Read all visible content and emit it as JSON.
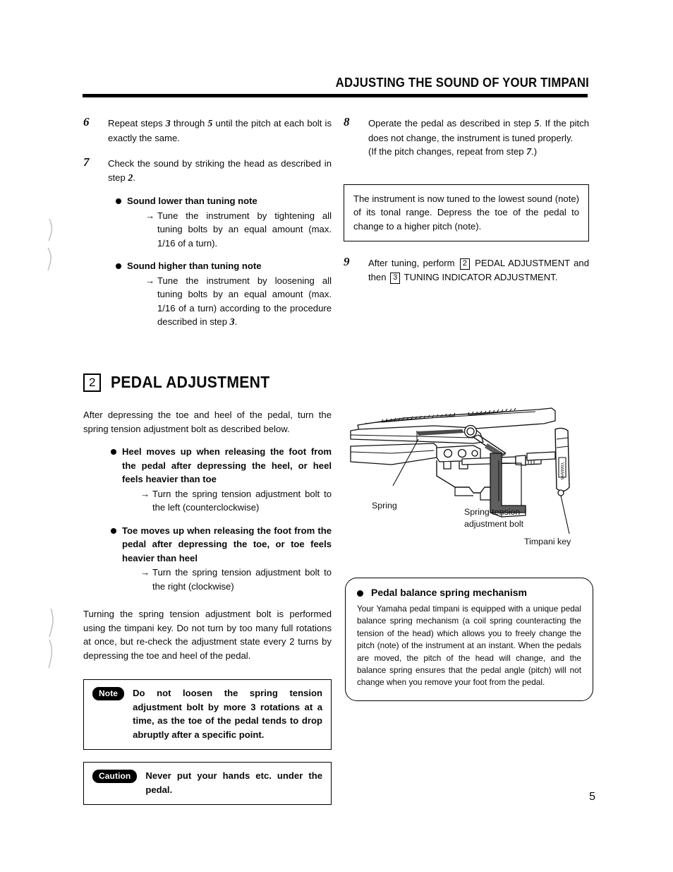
{
  "header": {
    "title": "ADJUSTING THE SOUND OF YOUR TIMPANI"
  },
  "left_column": {
    "step6": {
      "num": "6",
      "text_a": "Repeat steps ",
      "n3": "3",
      "text_b": " through ",
      "n5": "5",
      "text_c": " until the pitch at each bolt is exactly the same."
    },
    "step7": {
      "num": "7",
      "text_a": "Check the sound by striking the head as described in step ",
      "n2": "2",
      "text_b": "."
    },
    "bullet_lower": {
      "head": "Sound lower than tuning note",
      "arrow": "→",
      "detail": "Tune the instrument by tightening all tuning bolts by an equal amount (max. 1/16 of a turn)."
    },
    "bullet_higher": {
      "head": "Sound higher than tuning note",
      "arrow": "→",
      "detail_a": "Tune the instrument by loosening all tuning bolts by an equal amount (max. 1/16 of a turn) according to the procedure described in step ",
      "n3": "3",
      "detail_b": "."
    }
  },
  "right_column": {
    "step8": {
      "num": "8",
      "text_a": "Operate the pedal as described in step ",
      "n5": "5",
      "text_b": ". If the pitch does not change, the instrument is tuned properly.",
      "line2_a": "(If the pitch changes, repeat from step ",
      "n7": "7",
      "line2_b": ".)"
    },
    "info_box": "The instrument is now tuned to the lowest sound (note) of its tonal range. Depress the toe of the pedal to change to a higher pitch (note).",
    "step9": {
      "num": "9",
      "text_a": "After tuning, perform ",
      "box2": "2",
      "text_b": " PEDAL ADJUSTMENT and then ",
      "box3": "3",
      "text_c": " TUNING INDICATOR ADJUSTMENT."
    }
  },
  "section": {
    "number": "2",
    "title": "PEDAL ADJUSTMENT",
    "intro": "After depressing the toe and heel of the pedal, turn the spring tension adjustment bolt as described below.",
    "bullet_heel": {
      "head": "Heel moves up when releasing the foot from the pedal after depressing the heel, or heel feels heavier than toe",
      "arrow": "→",
      "detail": "Turn the spring tension adjustment bolt to the left (counterclockwise)"
    },
    "bullet_toe": {
      "head": "Toe moves up when releasing the foot from the pedal after depressing the toe, or toe feels heavier than heel",
      "arrow": "→",
      "detail": "Turn the spring tension adjustment bolt to the right (clockwise)"
    },
    "closing": "Turning the spring tension adjustment bolt is performed using the timpani key. Do not turn by too many full rotations at once, but re-check the adjustment state every 2 turns by depressing the toe and heel of the pedal."
  },
  "note": {
    "label": "Note",
    "text": "Do not loosen the spring tension adjustment bolt by more 3 rotations at a time, as the toe of the pedal tends to drop abruptly after a specific point."
  },
  "caution": {
    "label": "Caution",
    "text": "Never put your hands etc. under the pedal."
  },
  "figure": {
    "label_spring": "Spring",
    "label_bolt_line1": "Spring tension",
    "label_bolt_line2": "adjustment bolt",
    "label_key": "Timpani key",
    "key_brand": "YAMAHA"
  },
  "sidebar_box": {
    "heading": "Pedal balance spring mechanism",
    "body": "Your Yamaha pedal timpani is equipped with a unique pedal balance spring mechanism (a coil spring counteracting the tension of the head) which allows you to freely change the pitch (note) of the instrument at an instant. When the pedals are moved, the pitch of the head will change, and the balance spring ensures that the pedal angle (pitch) will not change when you remove your foot from the pedal."
  },
  "page_number": "5",
  "colors": {
    "ink": "#0a0a0a",
    "rule": "#000000",
    "shade": "#6d6d6d"
  }
}
